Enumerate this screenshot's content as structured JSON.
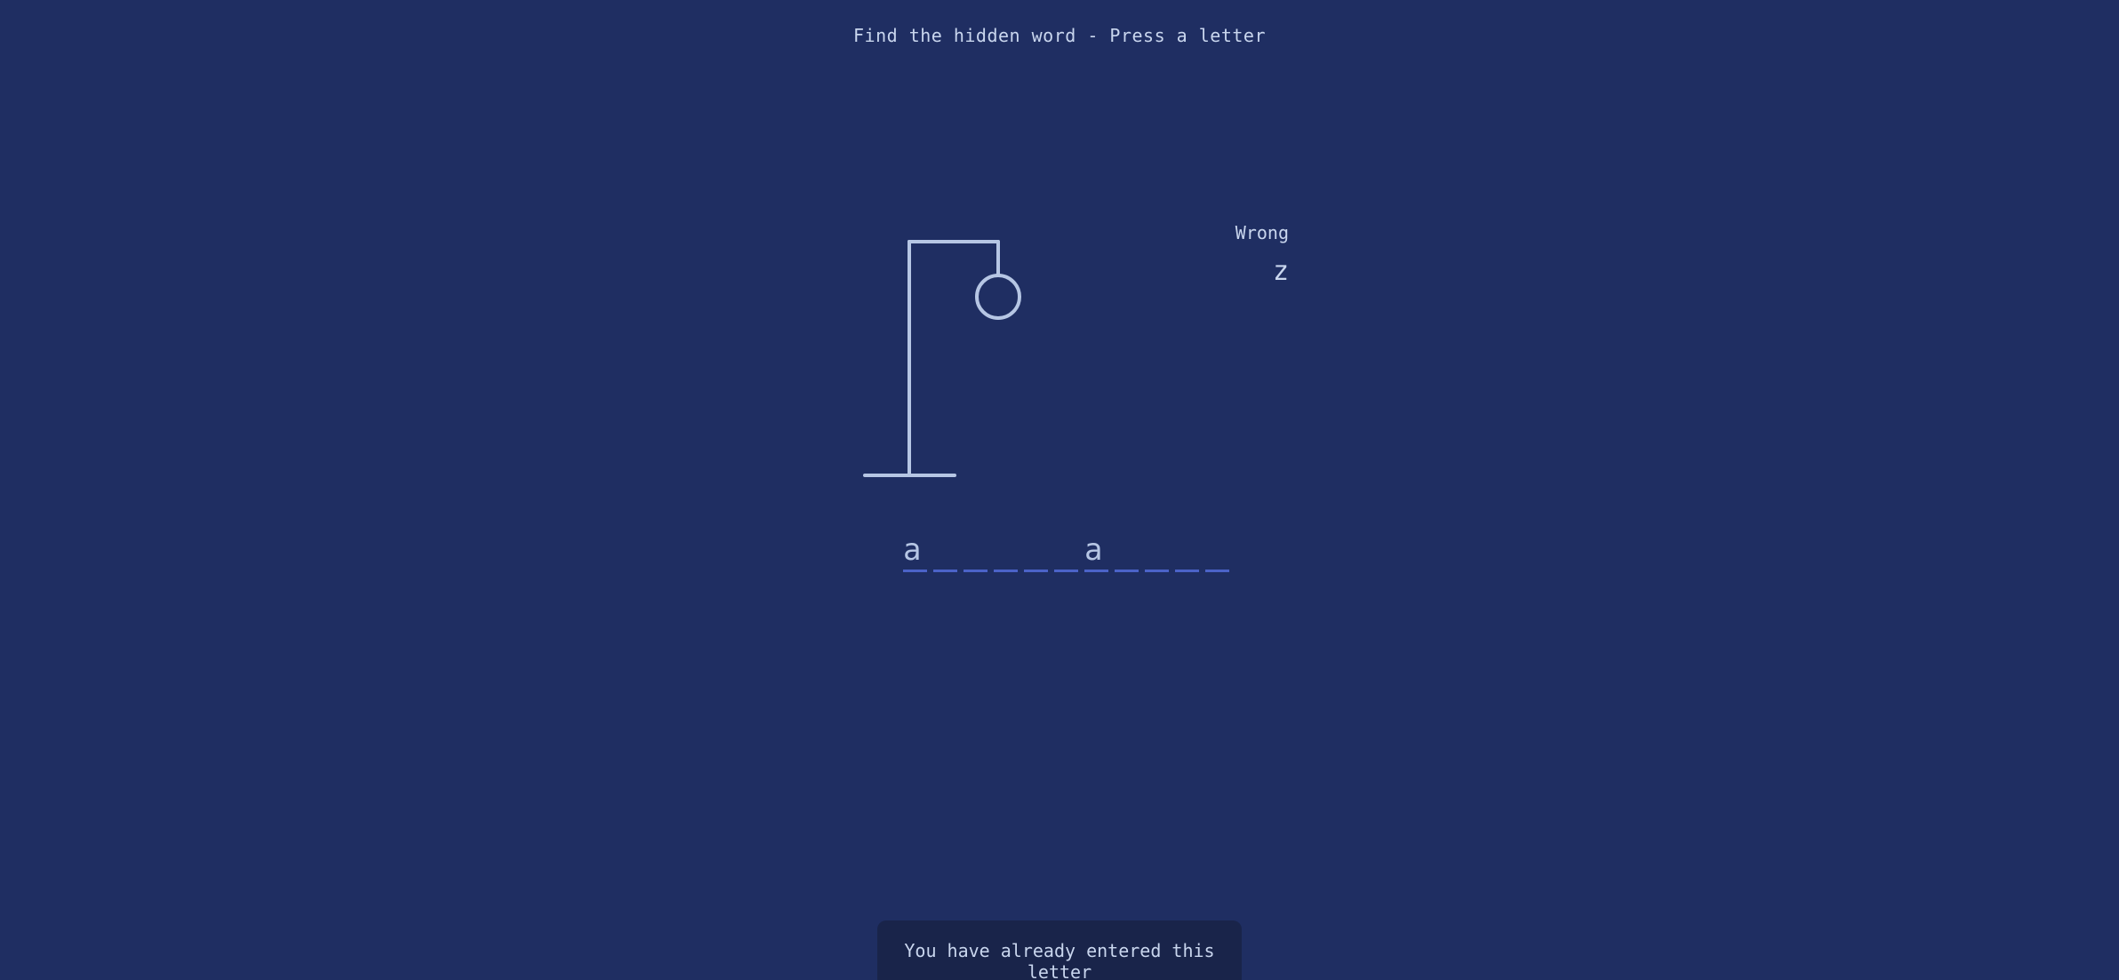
{
  "game": {
    "instruction": "Find the hidden word - Press a letter",
    "wrong_label": "Wrong",
    "wrong_letters": "z",
    "word_slots": [
      "a",
      "",
      "",
      "",
      "",
      "",
      "a",
      "",
      "",
      "",
      ""
    ],
    "toast_message": "You have already entered this letter"
  },
  "colors": {
    "background": "#1f2e62",
    "drawing": "#b6c6e4",
    "slot_underline": "#4b63c8",
    "toast_background": "#19244a"
  }
}
